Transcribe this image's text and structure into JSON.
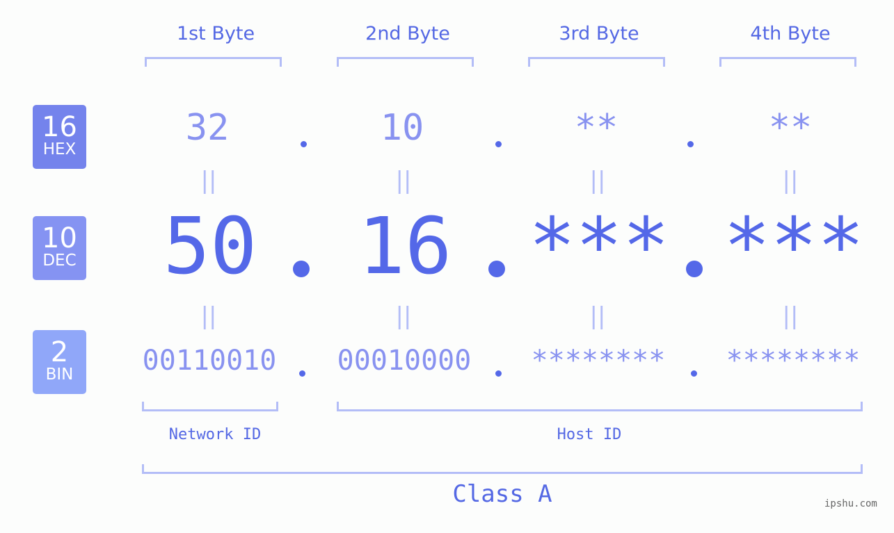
{
  "bytes": [
    {
      "label": "1st Byte",
      "hex": "32",
      "dec": "50",
      "bin": "00110010"
    },
    {
      "label": "2nd Byte",
      "hex": "10",
      "dec": "16",
      "bin": "00010000"
    },
    {
      "label": "3rd Byte",
      "hex": "**",
      "dec": "***",
      "bin": "********"
    },
    {
      "label": "4th Byte",
      "hex": "**",
      "dec": "***",
      "bin": "********"
    }
  ],
  "bases": {
    "hex": {
      "num": "16",
      "label": "HEX",
      "color": "#7483ec"
    },
    "dec": {
      "num": "10",
      "label": "DEC",
      "color": "#8593f2"
    },
    "bin": {
      "num": "2",
      "label": "BIN",
      "color": "#90a7f9"
    }
  },
  "equals_symbol": "||",
  "network_label": "Network ID",
  "host_label": "Host ID",
  "class_label": "Class A",
  "footer": "ipshu.com"
}
